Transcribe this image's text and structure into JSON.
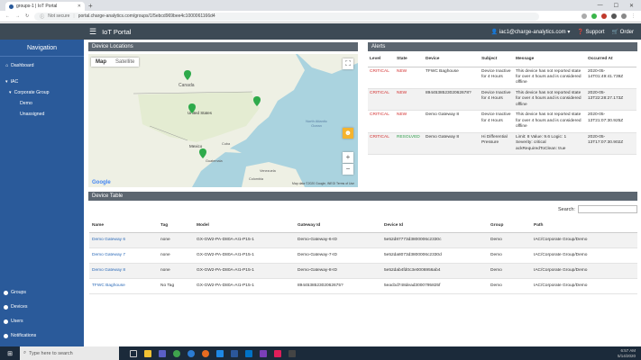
{
  "browser": {
    "tab_title": "groups-1 | IoT Portal",
    "security": "Not secure",
    "url": "portal.charge-analytics.com/groups/1/5ebcd969bee4c1000061166d4"
  },
  "app": {
    "title": "IoT Portal",
    "user": "iac1@charge-analytics.com",
    "support": "Support",
    "order": "Order"
  },
  "sidebar": {
    "title": "Navigation",
    "dashboard": "Dashboard",
    "tree": {
      "root": "IAC",
      "group": "Corporate Group",
      "children": [
        "Demo",
        "Unassigned"
      ]
    },
    "bottom": [
      "Groups",
      "Devices",
      "Users",
      "Notifications"
    ]
  },
  "map": {
    "header": "Device Locations",
    "tab_map": "Map",
    "tab_satellite": "Satellite",
    "labels": {
      "canada": "Canada",
      "united_states": "United States",
      "mexico": "Mexico",
      "north_atlantic": "North Atlantic Ocean",
      "cuba": "Cuba",
      "guatemala": "Guatemala",
      "venezuela": "Venezuela",
      "colombia": "Colombia"
    },
    "attribution": "Map data ©2020 Google, INEGI   Terms of Use",
    "zoom_in": "+",
    "zoom_out": "−"
  },
  "alerts": {
    "header": "Alerts",
    "columns": [
      "Level",
      "State",
      "Device",
      "Subject",
      "Message",
      "Occurred At"
    ],
    "rows": [
      {
        "level": "CRITICAL",
        "state": "NEW",
        "device": "TFWC Baghouse",
        "subject": "Device Inactive for 4 Hours",
        "message": "This device has not reported state for over 4 hours and is considered offline",
        "occurred": "2020-05-14T01:49:41.739Z"
      },
      {
        "level": "CRITICAL",
        "state": "NEW",
        "device": "894453852302062678?",
        "subject": "Device Inactive for 4 Hours",
        "message": "This device has not reported state for over 4 hours and is considered offline",
        "occurred": "2020-05-13T22:28:27.173Z"
      },
      {
        "level": "CRITICAL",
        "state": "NEW",
        "device": "Demo Gateway 8",
        "subject": "Device Inactive for 4 Hours",
        "message": "This device has not reported state for over 4 hours and is considered offline",
        "occurred": "2020-05-13T21:07:30.925Z"
      },
      {
        "level": "CRITICAL",
        "state": "RESOLVED",
        "device": "Demo Gateway 8",
        "subject": "Hi Differential Pressure",
        "message": "Limit: 8 Value: 9.6 Logic: 1 Severity: critical ackRequiredToClean: true",
        "occurred": "2020-05-13T17:07:30.902Z"
      }
    ]
  },
  "device_table": {
    "header": "Device Table",
    "search_label": "Search:",
    "columns": [
      "Name",
      "Tag",
      "Model",
      "Gateway Id",
      "Device Id",
      "Group",
      "Path"
    ],
    "rows": [
      {
        "name": "Demo Gateway 6",
        "tag": "none",
        "model": "GX-GW2-PA-D80A-AI1-P15-1",
        "gateway": "Demo-Gateway-6-ID",
        "device_id": "5e52d87773d3800006c2330c",
        "group": "Demo",
        "path": "IAC/Corporate Group/Demo"
      },
      {
        "name": "Demo Gateway 7",
        "tag": "none",
        "model": "GX-GW2-PA-D80A-AI1-P15-1",
        "gateway": "Demo-Gateway-7-ID",
        "device_id": "5e52da8073d3800006c2330d",
        "group": "Demo",
        "path": "IAC/Corporate Group/Demo"
      },
      {
        "name": "Demo Gateway 8",
        "tag": "none",
        "model": "GX-GW2-PA-D80A-AI1-P15-1",
        "gateway": "Demo-Gateway-8-ID",
        "device_id": "5e52dab4fd0c3e0006956ab4",
        "group": "Demo",
        "path": "IAC/Corporate Group/Demo"
      },
      {
        "name": "TFWC Baghouse",
        "tag": "No Tag",
        "model": "GX-GW2-PA-D80A-AI1-P15-1",
        "gateway": "894453852302062675?",
        "device_id": "5eacbd748dead3000795825f",
        "group": "Demo",
        "path": "IAC/Corporate Group/Demo"
      }
    ]
  },
  "taskbar": {
    "search": "Type here to search",
    "time": "6:57 AM",
    "date": "5/14/2020"
  }
}
